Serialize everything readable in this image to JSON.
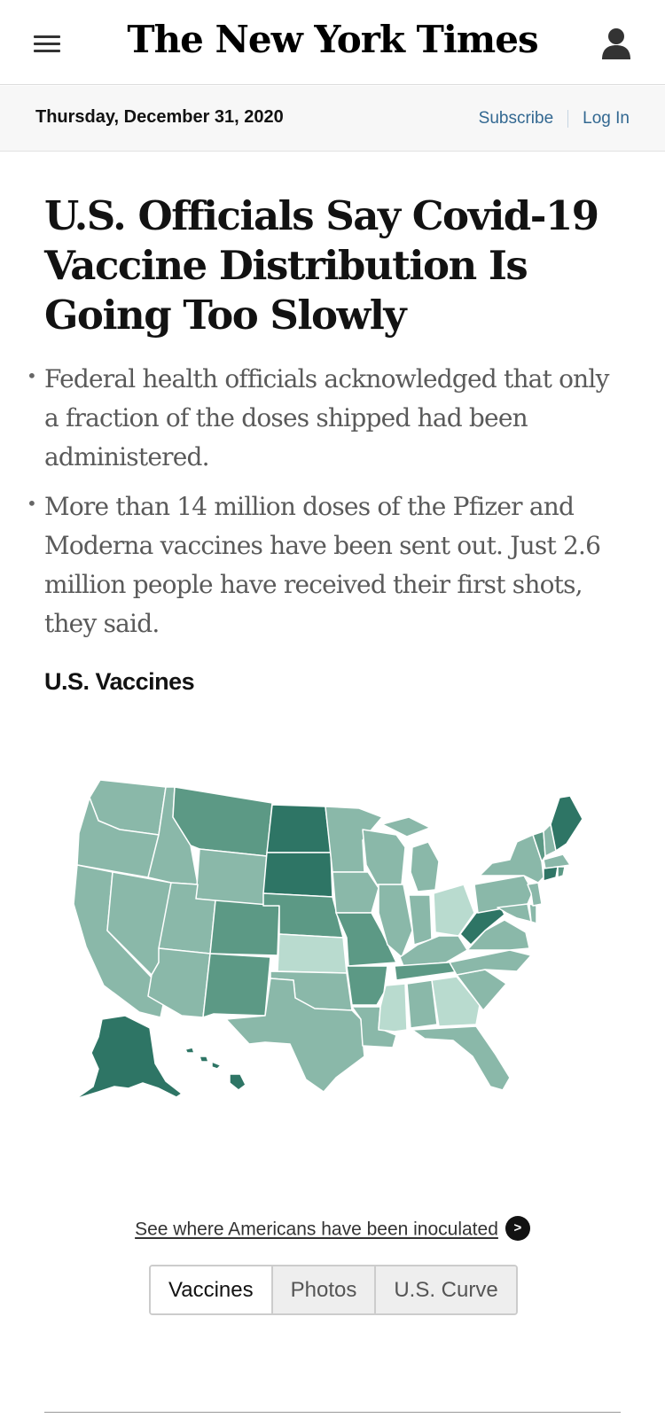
{
  "header": {
    "masthead": "The New York Times"
  },
  "datebar": {
    "date": "Thursday, December 31, 2020",
    "subscribe": "Subscribe",
    "login": "Log In"
  },
  "article": {
    "headline": "U.S. Officials Say Covid-19 Vaccine Distribution Is Going Too Slowly",
    "summary": [
      "Federal health officials acknowledged that only a fraction of the doses shipped had been administered.",
      "More than 14 million doses of the Pfizer and Moderna vaccines have been sent out. Just 2.6 million people have received their first shots, they said."
    ]
  },
  "module": {
    "label": "U.S. Vaccines",
    "cta": "See where Americans have been inoculated",
    "cta_icon": ">",
    "tabs": [
      "Vaccines",
      "Photos",
      "U.S. Curve"
    ]
  },
  "colors": {
    "brand_link": "#326891",
    "map_light": "#b9dbcf",
    "map_mid": "#8ab8a9",
    "map_strong": "#5c9985",
    "map_darkest": "#2e7565"
  },
  "icons": {
    "menu": "hamburger-menu-icon",
    "account": "account-icon",
    "cta_arrow": "arrow-right-icon"
  }
}
